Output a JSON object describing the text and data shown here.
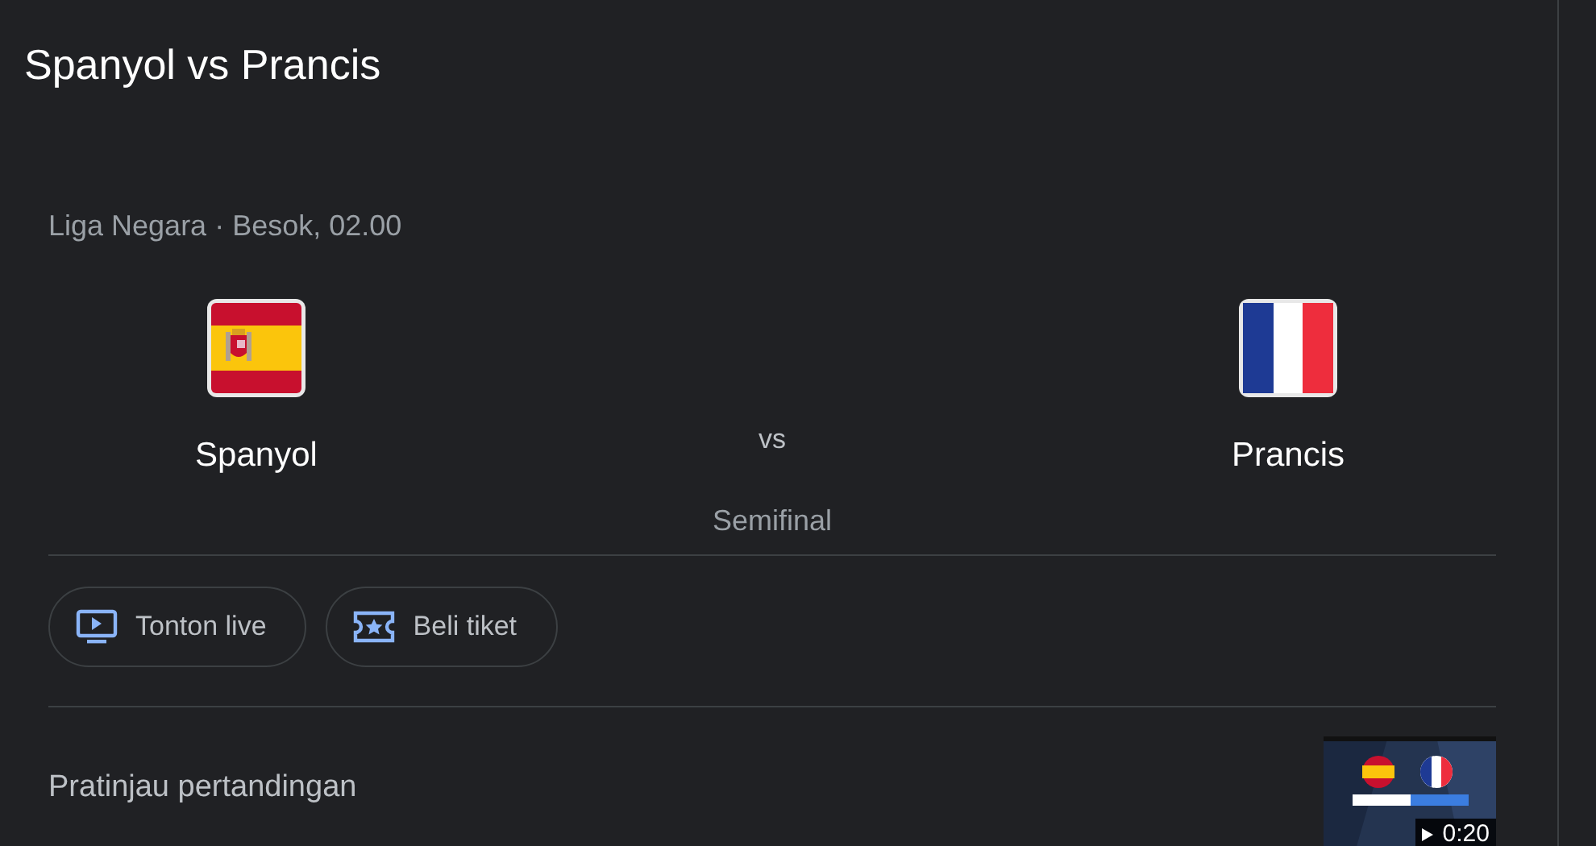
{
  "title": "Spanyol vs Prancis",
  "match": {
    "meta": "Liga Negara · Besok, 02.00",
    "teams": [
      {
        "name": "Spanyol",
        "kind": "spain"
      },
      {
        "name": "Prancis",
        "kind": "france"
      }
    ],
    "vs": "vs",
    "stage": "Semifinal"
  },
  "actions": [
    {
      "label": "Tonton live",
      "kind": "watch"
    },
    {
      "label": "Beli tiket",
      "kind": "tickets"
    }
  ],
  "preview": {
    "heading": "Pratinjau pertandingan",
    "video": {
      "kind": "picture",
      "duration": "0:20"
    }
  }
}
